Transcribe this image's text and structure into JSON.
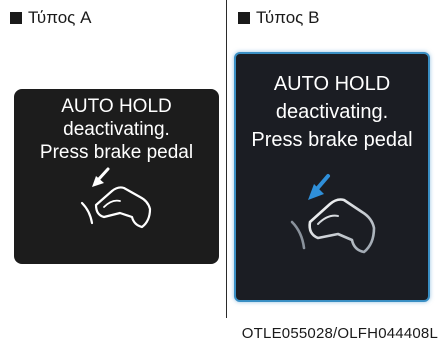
{
  "type_a": {
    "label": "Τύπος A",
    "message": [
      "AUTO HOLD",
      "deactivating.",
      "Press brake pedal"
    ]
  },
  "type_b": {
    "label": "Τύπος B",
    "message": [
      "AUTO HOLD",
      "deactivating.",
      "Press brake pedal"
    ],
    "accent_color": "#2f8fd9"
  },
  "reference_code": "OTLE055028/OLFH044408L",
  "icons": {
    "pedal": "brake-pedal-foot-icon",
    "arrow": "press-arrow-icon"
  },
  "colors": {
    "panel_background": "#1c1c1c",
    "panel_text": "#ffffff",
    "panel_b_border": "#3a8fc4"
  }
}
